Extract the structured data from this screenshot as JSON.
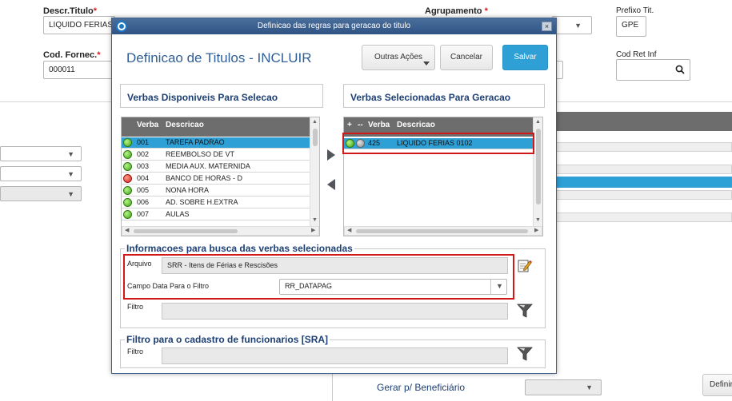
{
  "background": {
    "descr_titulo": {
      "label": "Descr.Titulo",
      "required_mark": "*",
      "value": "LIQUIDO FERIAS"
    },
    "agrupamento": {
      "label": "Agrupamento",
      "required_mark": "*"
    },
    "prefixo_tit": {
      "label": "Prefixo Tit.",
      "value": "GPE"
    },
    "cod_fornec": {
      "label": "Cod. Fornec.",
      "required_mark": "*",
      "value": "000011"
    },
    "cod_ret_inf": {
      "label": "Cod Ret Inf"
    },
    "gerar_beneficiario": "Gerar p/ Beneficiário",
    "definir_button": "Definir"
  },
  "modal": {
    "window_title": "Definicao das regras para geracao do titulo",
    "close_label": "×",
    "heading": "Definicao de Titulos - INCLUIR",
    "buttons": {
      "outras": "Outras Ações",
      "cancel": "Cancelar",
      "save": "Salvar"
    },
    "available": {
      "title": "Verbas Disponiveis Para Selecao",
      "columns": {
        "verba": "Verba",
        "descricao": "Descricao"
      },
      "rows": [
        {
          "status": "green",
          "verba": "001",
          "descricao": "TAREFA PADRAO",
          "selected": true
        },
        {
          "status": "green",
          "verba": "002",
          "descricao": "REEMBOLSO DE VT"
        },
        {
          "status": "green",
          "verba": "003",
          "descricao": "MEDIA AUX. MATERNIDA"
        },
        {
          "status": "red",
          "verba": "004",
          "descricao": "BANCO DE HORAS - D"
        },
        {
          "status": "green",
          "verba": "005",
          "descricao": "NONA HORA"
        },
        {
          "status": "green",
          "verba": "006",
          "descricao": "AD. SOBRE H.EXTRA"
        },
        {
          "status": "green",
          "verba": "007",
          "descricao": "AULAS"
        }
      ]
    },
    "selected": {
      "title": "Verbas Selecionadas Para Geracao",
      "columns": {
        "plus": "+",
        "dash": "--",
        "verba": "Verba",
        "descricao": "Descricao"
      },
      "rows": [
        {
          "verba": "425",
          "descricao": "LIQUIDO FERIAS 0102",
          "selected": true
        }
      ]
    },
    "busca": {
      "legend": "Informacoes para busca das verbas selecionadas",
      "arquivo_label": "Arquivo",
      "arquivo_value": "SRR - Itens de Férias e Rescisões",
      "campo_data_label": "Campo Data Para o Filtro",
      "campo_data_value": "RR_DATAPAG",
      "filtro_label": "Filtro"
    },
    "funcionarios": {
      "legend": "Filtro para o cadastro de funcionarios [SRA]",
      "filtro_label": "Filtro"
    }
  },
  "icons": {
    "search": "search-icon",
    "edit": "edit-pencil-icon",
    "filter": "funnel-icon",
    "move_right": "arrow-right-icon",
    "move_left": "arrow-left-icon"
  },
  "colors": {
    "accent": "#2ea0d6",
    "title_bar": "#2f5384",
    "highlight": "#d01818"
  }
}
